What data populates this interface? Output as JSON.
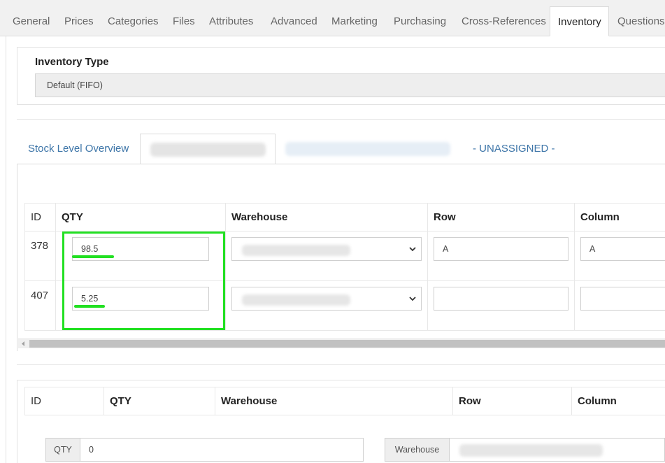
{
  "top_tabs": [
    {
      "label": "General"
    },
    {
      "label": "Prices"
    },
    {
      "label": "Categories"
    },
    {
      "label": "Files"
    },
    {
      "label": "Attributes"
    },
    {
      "label": "Advanced"
    },
    {
      "label": "Marketing"
    },
    {
      "label": "Purchasing"
    },
    {
      "label": "Cross-References"
    },
    {
      "label": "Inventory"
    },
    {
      "label": "Questions"
    }
  ],
  "active_top_tab": "Inventory",
  "inventory_type": {
    "label": "Inventory Type",
    "value": "Default (FIFO)"
  },
  "sub_tabs": [
    {
      "label": "Stock Level Overview"
    },
    {
      "label": ""
    },
    {
      "label": ""
    },
    {
      "label": "- UNASSIGNED -"
    }
  ],
  "stock_table": {
    "headers": [
      "ID",
      "QTY",
      "Warehouse",
      "Row",
      "Column"
    ],
    "rows": [
      {
        "id": "378",
        "qty": "98.5",
        "warehouse": "",
        "row": "A",
        "column": "A"
      },
      {
        "id": "407",
        "qty": "5.25",
        "warehouse": "",
        "row": "",
        "column": ""
      }
    ]
  },
  "new_table": {
    "headers": [
      "ID",
      "QTY",
      "Warehouse",
      "Row",
      "Column"
    ]
  },
  "new_entry": {
    "qty_label": "QTY",
    "qty_value": "0",
    "warehouse_label": "Warehouse",
    "warehouse_value": ""
  },
  "colors": {
    "link": "#3d75a8",
    "highlight": "#22e022"
  }
}
